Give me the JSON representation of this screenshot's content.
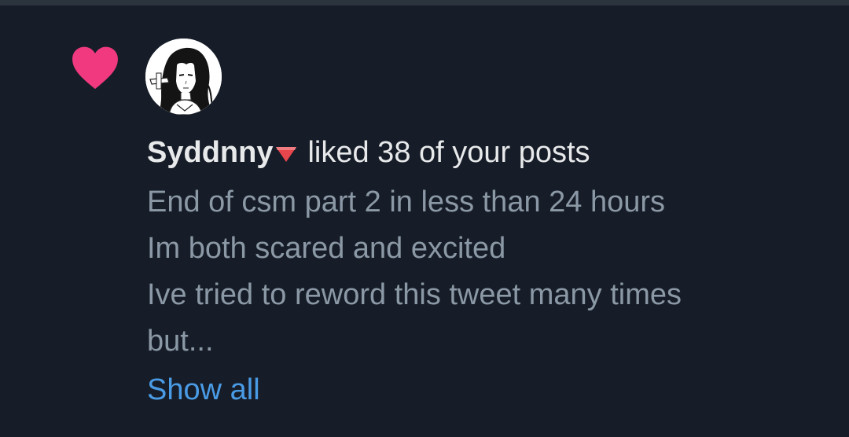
{
  "notification": {
    "icon": "heart-icon",
    "icon_color": "#f0397f",
    "user": {
      "name": "Syddnny",
      "name_emoji": "red-triangle-pointed-down",
      "avatar": "anime-girl-avatar"
    },
    "action_text": "liked 38 of your posts",
    "post_preview": "End of csm part 2 in less than 24 hours\nIm both scared and excited\nIve tried to reword this tweet many times\nbut...",
    "show_all_label": "Show all"
  },
  "colors": {
    "background": "#161d28",
    "primary_text": "#e7e9ea",
    "secondary_text": "#8b98a5",
    "link": "#4a9be5"
  }
}
